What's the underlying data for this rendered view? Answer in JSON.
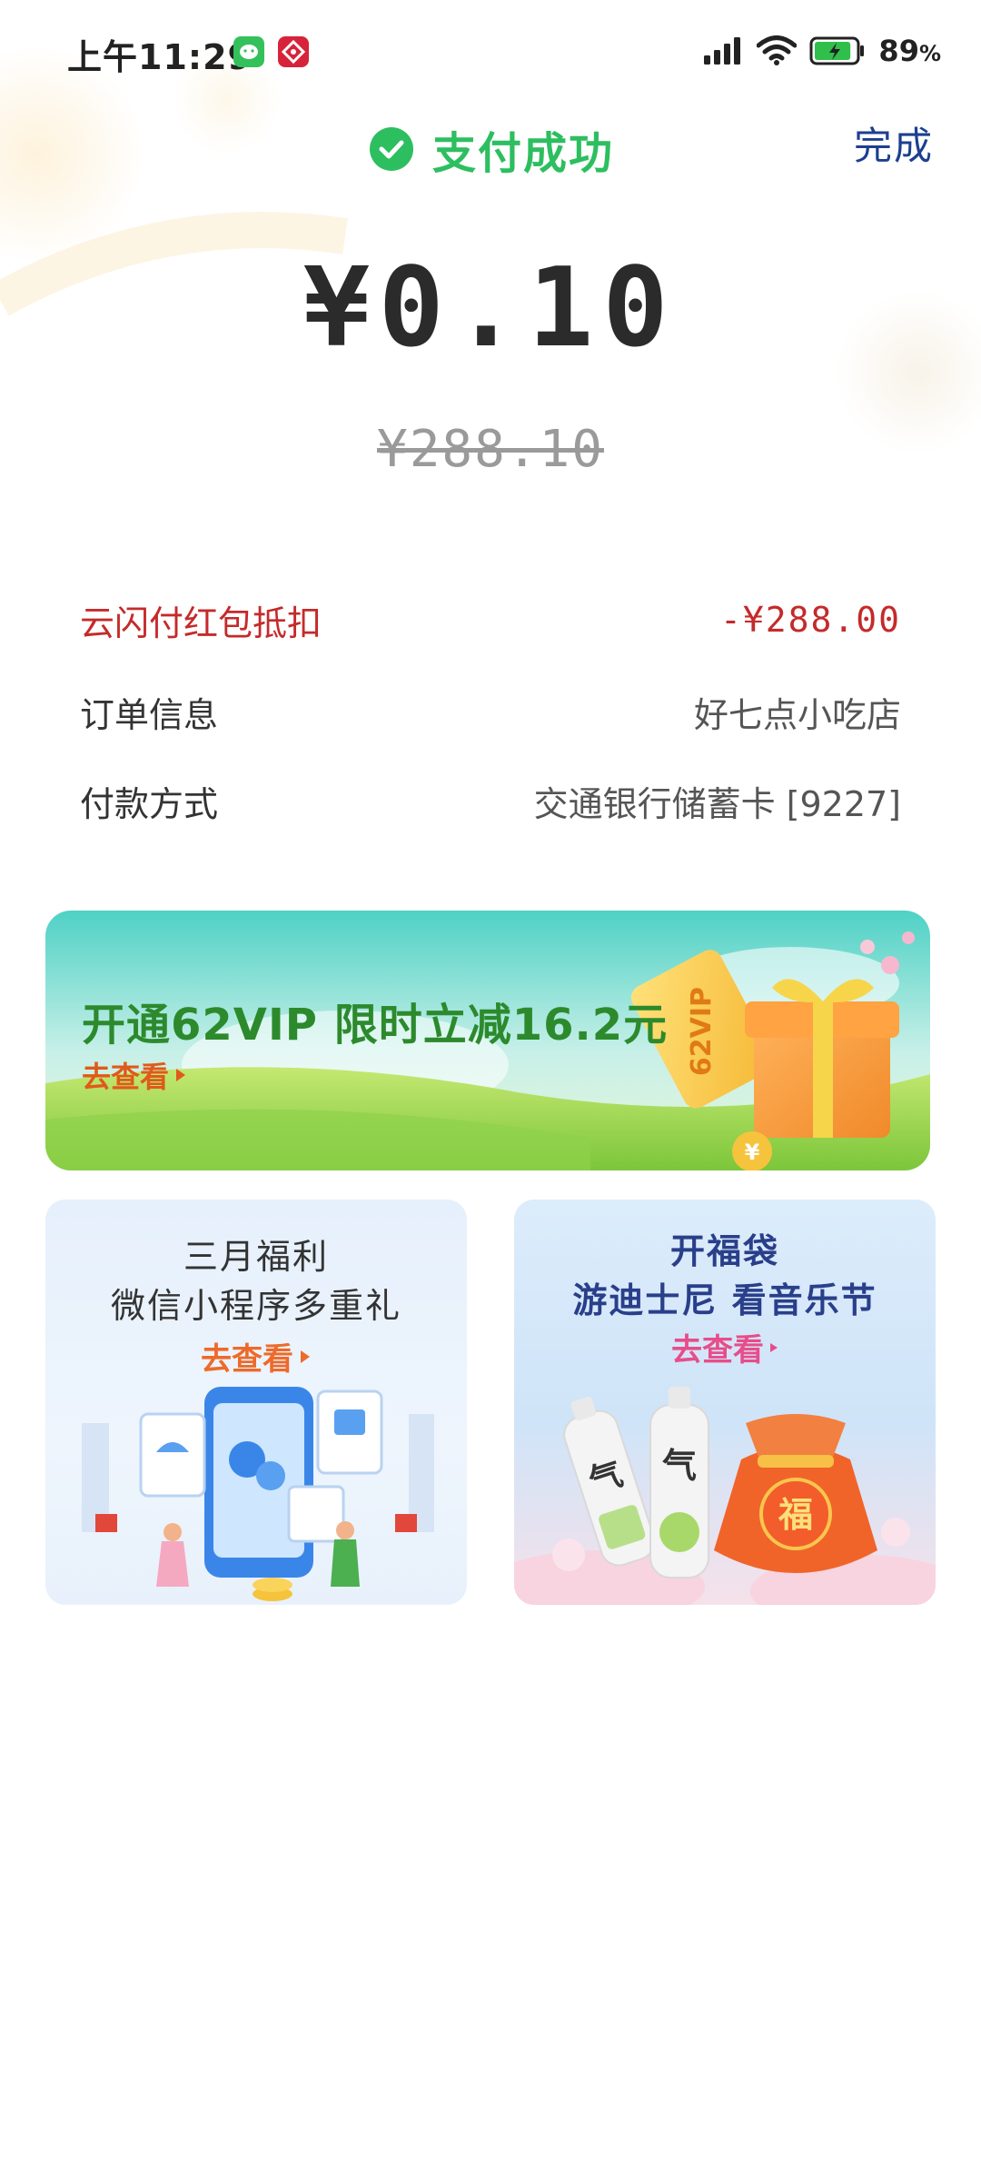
{
  "status_bar": {
    "time": "上午11:29",
    "battery_percent": "89",
    "battery_unit": "%",
    "battery_level": 0.89
  },
  "header": {
    "title": "支付成功",
    "done_label": "完成"
  },
  "payment": {
    "amount": "¥0.10",
    "original_amount": "¥288.10"
  },
  "details": [
    {
      "label": "云闪付红包抵扣",
      "value": "-¥288.00"
    },
    {
      "label": "订单信息",
      "value": "好七点小吃店"
    },
    {
      "label": "付款方式",
      "value": "交通银行储蓄卡 [9227]"
    }
  ],
  "vip_banner": {
    "title": "开通62VIP 限时立减16.2元",
    "link": "去查看",
    "ticket_text": "62VIP"
  },
  "cards": [
    {
      "title_line1": "三月福利",
      "title_line2": "微信小程序多重礼",
      "link": "去查看"
    },
    {
      "title_line1": "开福袋",
      "title_line2": "游迪士尼 看音乐节",
      "link": "去查看",
      "bag_text": "福"
    }
  ],
  "colors": {
    "success_green": "#2dbe60",
    "done_blue": "#1c3f8f",
    "discount_red": "#c52a2a",
    "link_orange": "#ee6a2a",
    "link_pink": "#e74d8a"
  }
}
